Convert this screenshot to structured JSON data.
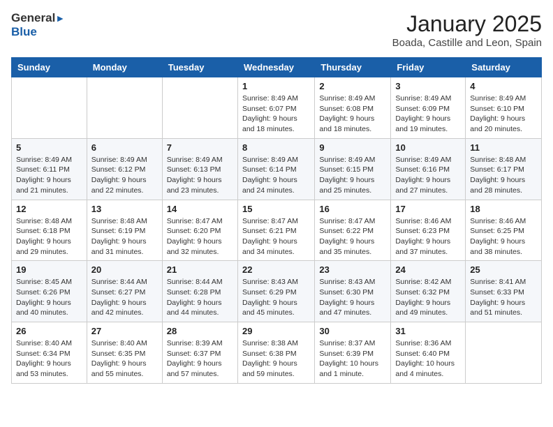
{
  "header": {
    "logo_general": "General",
    "logo_blue": "Blue",
    "title": "January 2025",
    "subtitle": "Boada, Castille and Leon, Spain"
  },
  "days_of_week": [
    "Sunday",
    "Monday",
    "Tuesday",
    "Wednesday",
    "Thursday",
    "Friday",
    "Saturday"
  ],
  "weeks": [
    [
      {
        "day": "",
        "info": ""
      },
      {
        "day": "",
        "info": ""
      },
      {
        "day": "",
        "info": ""
      },
      {
        "day": "1",
        "info": "Sunrise: 8:49 AM\nSunset: 6:07 PM\nDaylight: 9 hours\nand 18 minutes."
      },
      {
        "day": "2",
        "info": "Sunrise: 8:49 AM\nSunset: 6:08 PM\nDaylight: 9 hours\nand 18 minutes."
      },
      {
        "day": "3",
        "info": "Sunrise: 8:49 AM\nSunset: 6:09 PM\nDaylight: 9 hours\nand 19 minutes."
      },
      {
        "day": "4",
        "info": "Sunrise: 8:49 AM\nSunset: 6:10 PM\nDaylight: 9 hours\nand 20 minutes."
      }
    ],
    [
      {
        "day": "5",
        "info": "Sunrise: 8:49 AM\nSunset: 6:11 PM\nDaylight: 9 hours\nand 21 minutes."
      },
      {
        "day": "6",
        "info": "Sunrise: 8:49 AM\nSunset: 6:12 PM\nDaylight: 9 hours\nand 22 minutes."
      },
      {
        "day": "7",
        "info": "Sunrise: 8:49 AM\nSunset: 6:13 PM\nDaylight: 9 hours\nand 23 minutes."
      },
      {
        "day": "8",
        "info": "Sunrise: 8:49 AM\nSunset: 6:14 PM\nDaylight: 9 hours\nand 24 minutes."
      },
      {
        "day": "9",
        "info": "Sunrise: 8:49 AM\nSunset: 6:15 PM\nDaylight: 9 hours\nand 25 minutes."
      },
      {
        "day": "10",
        "info": "Sunrise: 8:49 AM\nSunset: 6:16 PM\nDaylight: 9 hours\nand 27 minutes."
      },
      {
        "day": "11",
        "info": "Sunrise: 8:48 AM\nSunset: 6:17 PM\nDaylight: 9 hours\nand 28 minutes."
      }
    ],
    [
      {
        "day": "12",
        "info": "Sunrise: 8:48 AM\nSunset: 6:18 PM\nDaylight: 9 hours\nand 29 minutes."
      },
      {
        "day": "13",
        "info": "Sunrise: 8:48 AM\nSunset: 6:19 PM\nDaylight: 9 hours\nand 31 minutes."
      },
      {
        "day": "14",
        "info": "Sunrise: 8:47 AM\nSunset: 6:20 PM\nDaylight: 9 hours\nand 32 minutes."
      },
      {
        "day": "15",
        "info": "Sunrise: 8:47 AM\nSunset: 6:21 PM\nDaylight: 9 hours\nand 34 minutes."
      },
      {
        "day": "16",
        "info": "Sunrise: 8:47 AM\nSunset: 6:22 PM\nDaylight: 9 hours\nand 35 minutes."
      },
      {
        "day": "17",
        "info": "Sunrise: 8:46 AM\nSunset: 6:23 PM\nDaylight: 9 hours\nand 37 minutes."
      },
      {
        "day": "18",
        "info": "Sunrise: 8:46 AM\nSunset: 6:25 PM\nDaylight: 9 hours\nand 38 minutes."
      }
    ],
    [
      {
        "day": "19",
        "info": "Sunrise: 8:45 AM\nSunset: 6:26 PM\nDaylight: 9 hours\nand 40 minutes."
      },
      {
        "day": "20",
        "info": "Sunrise: 8:44 AM\nSunset: 6:27 PM\nDaylight: 9 hours\nand 42 minutes."
      },
      {
        "day": "21",
        "info": "Sunrise: 8:44 AM\nSunset: 6:28 PM\nDaylight: 9 hours\nand 44 minutes."
      },
      {
        "day": "22",
        "info": "Sunrise: 8:43 AM\nSunset: 6:29 PM\nDaylight: 9 hours\nand 45 minutes."
      },
      {
        "day": "23",
        "info": "Sunrise: 8:43 AM\nSunset: 6:30 PM\nDaylight: 9 hours\nand 47 minutes."
      },
      {
        "day": "24",
        "info": "Sunrise: 8:42 AM\nSunset: 6:32 PM\nDaylight: 9 hours\nand 49 minutes."
      },
      {
        "day": "25",
        "info": "Sunrise: 8:41 AM\nSunset: 6:33 PM\nDaylight: 9 hours\nand 51 minutes."
      }
    ],
    [
      {
        "day": "26",
        "info": "Sunrise: 8:40 AM\nSunset: 6:34 PM\nDaylight: 9 hours\nand 53 minutes."
      },
      {
        "day": "27",
        "info": "Sunrise: 8:40 AM\nSunset: 6:35 PM\nDaylight: 9 hours\nand 55 minutes."
      },
      {
        "day": "28",
        "info": "Sunrise: 8:39 AM\nSunset: 6:37 PM\nDaylight: 9 hours\nand 57 minutes."
      },
      {
        "day": "29",
        "info": "Sunrise: 8:38 AM\nSunset: 6:38 PM\nDaylight: 9 hours\nand 59 minutes."
      },
      {
        "day": "30",
        "info": "Sunrise: 8:37 AM\nSunset: 6:39 PM\nDaylight: 10 hours\nand 1 minute."
      },
      {
        "day": "31",
        "info": "Sunrise: 8:36 AM\nSunset: 6:40 PM\nDaylight: 10 hours\nand 4 minutes."
      },
      {
        "day": "",
        "info": ""
      }
    ]
  ]
}
